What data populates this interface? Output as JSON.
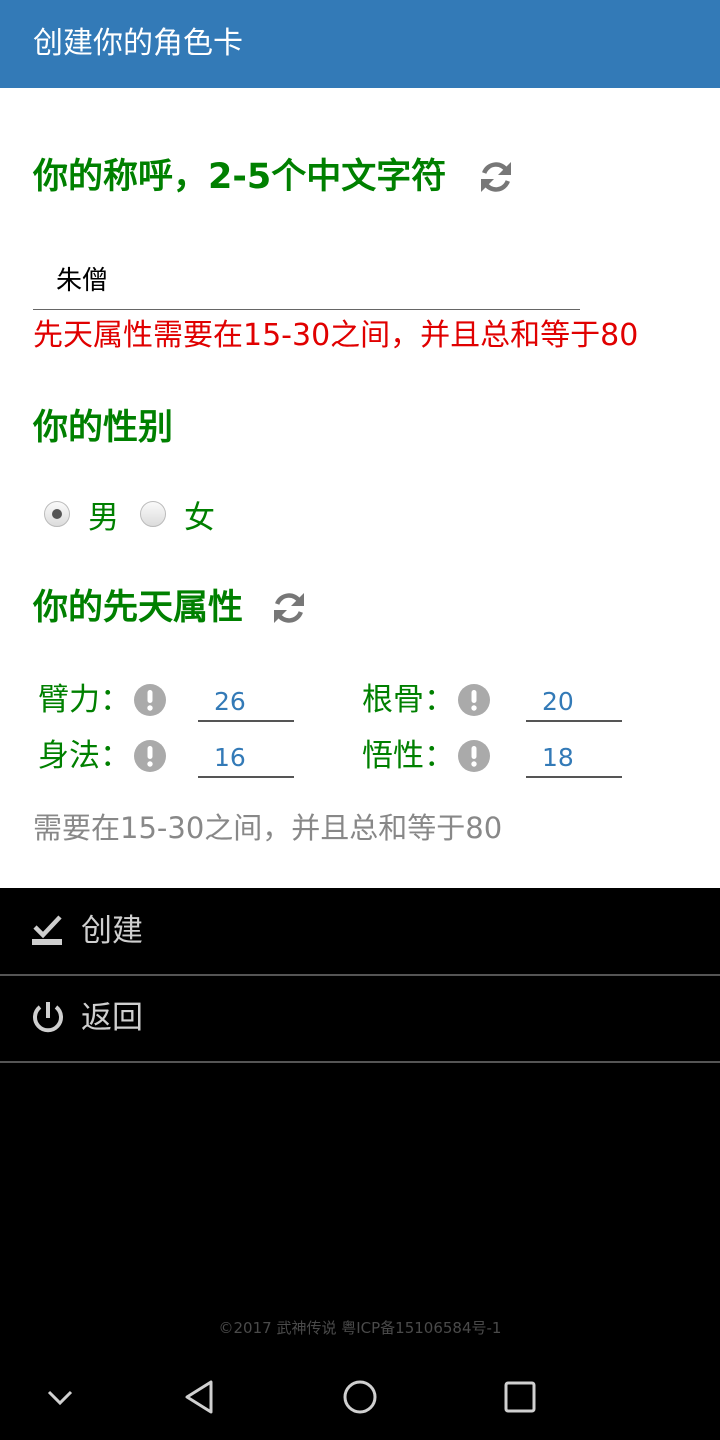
{
  "header": {
    "title": "创建你的角色卡"
  },
  "name_section": {
    "heading": "你的称呼，2-5个中文字符",
    "input_value": "朱僧",
    "error": "先天属性需要在15-30之间，并且总和等于80"
  },
  "gender_section": {
    "heading": "你的性别",
    "options": [
      {
        "label": "男",
        "selected": true
      },
      {
        "label": "女",
        "selected": false
      }
    ]
  },
  "attributes_section": {
    "heading": "你的先天属性",
    "attributes": [
      {
        "label": "臂力：",
        "value": "26"
      },
      {
        "label": "根骨：",
        "value": "20"
      },
      {
        "label": "身法：",
        "value": "16"
      },
      {
        "label": "悟性：",
        "value": "18"
      }
    ],
    "hint": "需要在15-30之间，并且总和等于80"
  },
  "menu": [
    {
      "label": "创建",
      "icon": "download-check-icon"
    },
    {
      "label": "返回",
      "icon": "power-icon"
    }
  ],
  "footer": {
    "text": "©2017 武神传说 粤ICP备15106584号-1"
  },
  "nav": [
    "chevron-down-icon",
    "back-triangle-icon",
    "home-circle-icon",
    "recents-square-icon"
  ],
  "colors": {
    "header": "#337ab7",
    "heading": "#008000",
    "error": "#e00000",
    "value": "#337ab7"
  }
}
